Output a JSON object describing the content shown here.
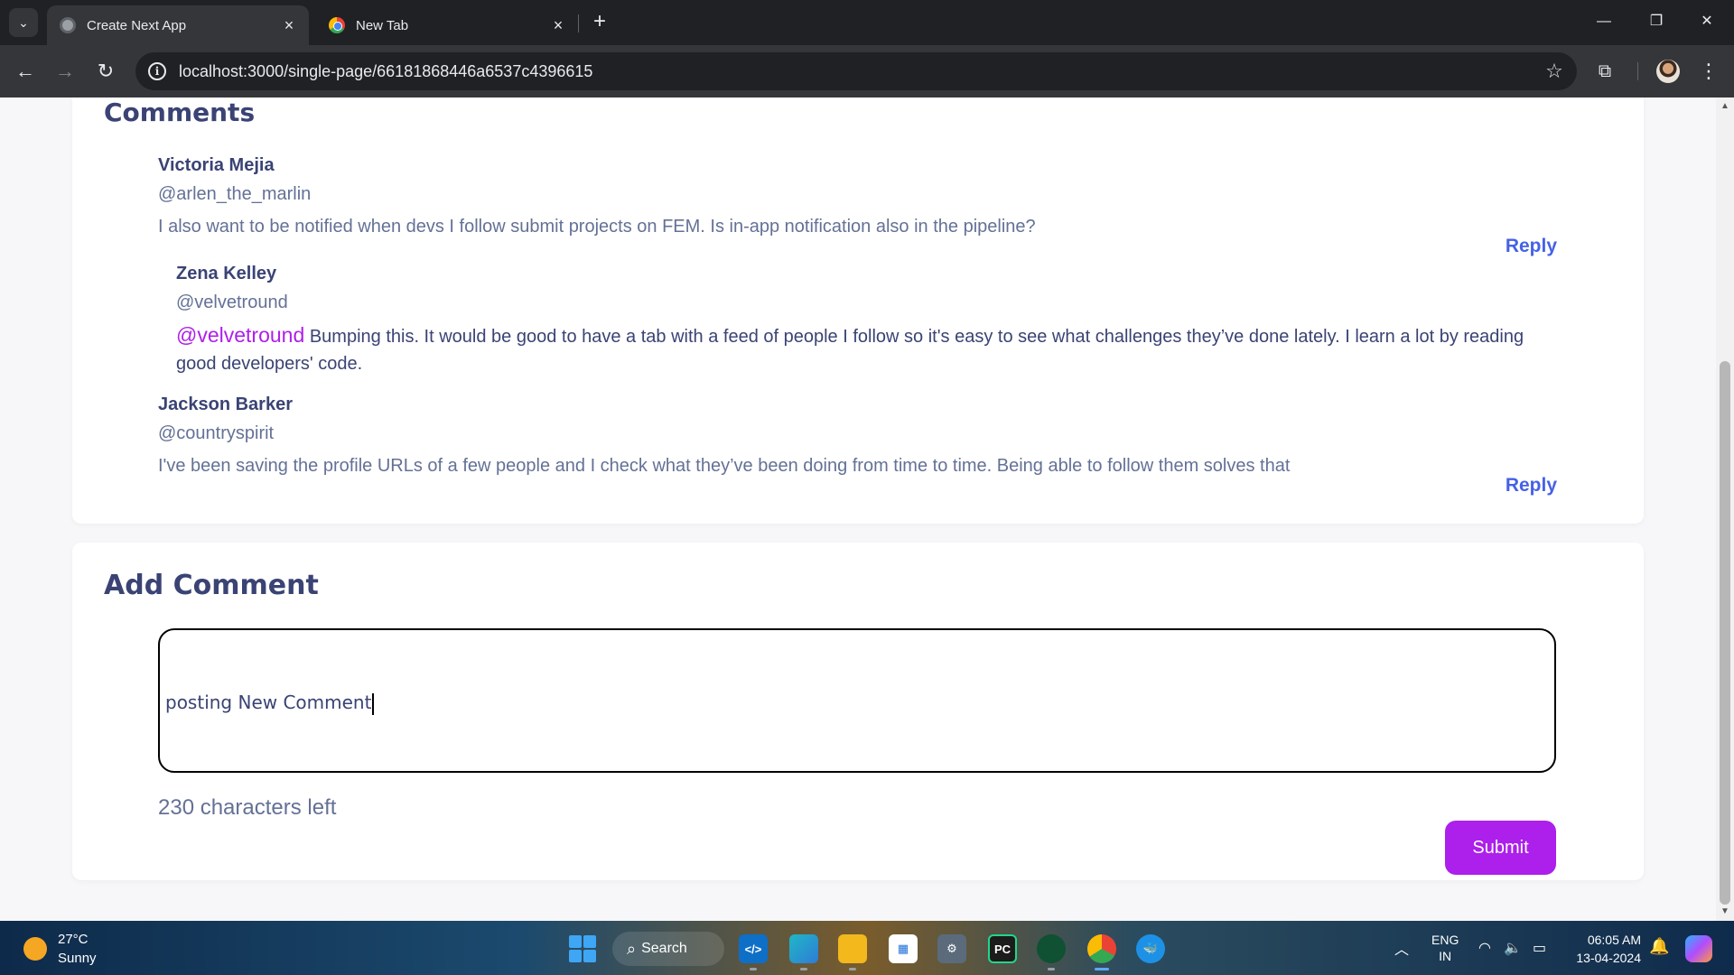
{
  "browser": {
    "tabs": [
      {
        "title": "Create Next App",
        "active": true
      },
      {
        "title": "New Tab",
        "active": false
      }
    ],
    "url": "localhost:3000/single-page/66181868446a6537c4396615"
  },
  "comments": {
    "title": "Comments",
    "items": [
      {
        "name": "Victoria Mejia",
        "handle": "@arlen_the_marlin",
        "body": "I also want to be notified when devs I follow submit projects on FEM. Is in-app notification also in the pipeline?",
        "reply_label": "Reply"
      },
      {
        "name": "Zena Kelley",
        "handle": "@velvetround",
        "mention": "@velvetround",
        "body": "Bumping this. It would be good to have a tab with a feed of people I follow so it's easy to see what challenges they’ve done lately. I learn a lot by reading good developers' code."
      },
      {
        "name": "Jackson Barker",
        "handle": "@countryspirit",
        "body": "I've been saving the profile URLs of a few people and I check what they’ve been doing from time to time. Being able to follow them solves that",
        "reply_label": "Reply"
      }
    ]
  },
  "add_comment": {
    "title": "Add Comment",
    "value": "posting New Comment",
    "chars_left": "230 characters left",
    "submit_label": "Submit"
  },
  "taskbar": {
    "weather": {
      "temp": "27°C",
      "condition": "Sunny"
    },
    "search_label": "Search",
    "language": {
      "line1": "ENG",
      "line2": "IN"
    },
    "time": "06:05 AM",
    "date": "13-04-2024"
  },
  "colors": {
    "heading": "#3a4374",
    "body_text": "#647196",
    "link": "#4661e6",
    "accent": "#ad1fea"
  }
}
